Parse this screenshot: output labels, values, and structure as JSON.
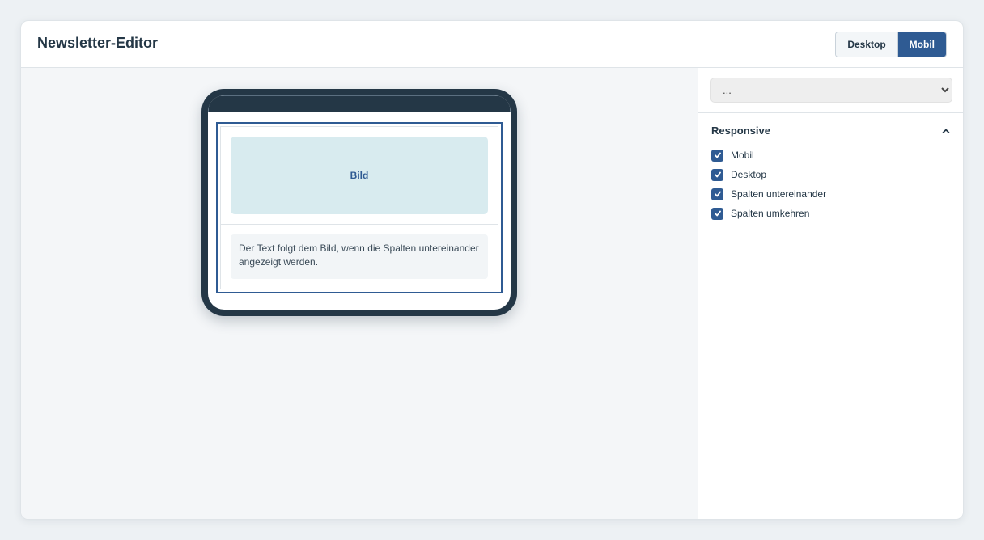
{
  "header": {
    "title": "Newsletter-Editor",
    "view_toggle": {
      "desktop_label": "Desktop",
      "mobile_label": "Mobil",
      "active": "Mobil"
    }
  },
  "preview": {
    "image_label": "Bild",
    "text": "Der Text folgt dem Bild, wenn die Spalten untereinander angezeigt werden."
  },
  "sidebar": {
    "select": {
      "value": "..."
    },
    "section": {
      "title": "Responsive",
      "options": [
        {
          "label": "Mobil",
          "checked": true
        },
        {
          "label": "Desktop",
          "checked": true
        },
        {
          "label": "Spalten untereinander",
          "checked": true
        },
        {
          "label": "Spalten umkehren",
          "checked": true
        }
      ]
    }
  },
  "colors": {
    "accent": "#2f5b93",
    "frame": "#243746",
    "image_placeholder": "#d8ebef"
  },
  "icons": {
    "section_toggle": "chevron-up-icon",
    "checkbox": "check-icon"
  }
}
